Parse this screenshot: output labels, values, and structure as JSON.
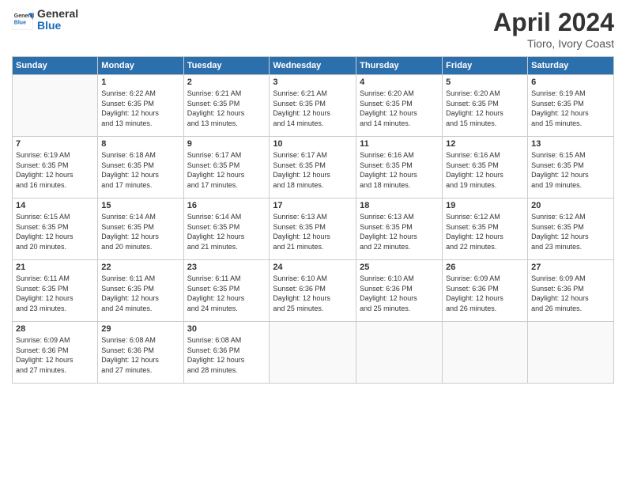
{
  "header": {
    "logo_general": "General",
    "logo_blue": "Blue",
    "month_title": "April 2024",
    "subtitle": "Tioro, Ivory Coast"
  },
  "days_of_week": [
    "Sunday",
    "Monday",
    "Tuesday",
    "Wednesday",
    "Thursday",
    "Friday",
    "Saturday"
  ],
  "weeks": [
    [
      {
        "day": "",
        "info": ""
      },
      {
        "day": "1",
        "info": "Sunrise: 6:22 AM\nSunset: 6:35 PM\nDaylight: 12 hours\nand 13 minutes."
      },
      {
        "day": "2",
        "info": "Sunrise: 6:21 AM\nSunset: 6:35 PM\nDaylight: 12 hours\nand 13 minutes."
      },
      {
        "day": "3",
        "info": "Sunrise: 6:21 AM\nSunset: 6:35 PM\nDaylight: 12 hours\nand 14 minutes."
      },
      {
        "day": "4",
        "info": "Sunrise: 6:20 AM\nSunset: 6:35 PM\nDaylight: 12 hours\nand 14 minutes."
      },
      {
        "day": "5",
        "info": "Sunrise: 6:20 AM\nSunset: 6:35 PM\nDaylight: 12 hours\nand 15 minutes."
      },
      {
        "day": "6",
        "info": "Sunrise: 6:19 AM\nSunset: 6:35 PM\nDaylight: 12 hours\nand 15 minutes."
      }
    ],
    [
      {
        "day": "7",
        "info": "Sunrise: 6:19 AM\nSunset: 6:35 PM\nDaylight: 12 hours\nand 16 minutes."
      },
      {
        "day": "8",
        "info": "Sunrise: 6:18 AM\nSunset: 6:35 PM\nDaylight: 12 hours\nand 17 minutes."
      },
      {
        "day": "9",
        "info": "Sunrise: 6:17 AM\nSunset: 6:35 PM\nDaylight: 12 hours\nand 17 minutes."
      },
      {
        "day": "10",
        "info": "Sunrise: 6:17 AM\nSunset: 6:35 PM\nDaylight: 12 hours\nand 18 minutes."
      },
      {
        "day": "11",
        "info": "Sunrise: 6:16 AM\nSunset: 6:35 PM\nDaylight: 12 hours\nand 18 minutes."
      },
      {
        "day": "12",
        "info": "Sunrise: 6:16 AM\nSunset: 6:35 PM\nDaylight: 12 hours\nand 19 minutes."
      },
      {
        "day": "13",
        "info": "Sunrise: 6:15 AM\nSunset: 6:35 PM\nDaylight: 12 hours\nand 19 minutes."
      }
    ],
    [
      {
        "day": "14",
        "info": "Sunrise: 6:15 AM\nSunset: 6:35 PM\nDaylight: 12 hours\nand 20 minutes."
      },
      {
        "day": "15",
        "info": "Sunrise: 6:14 AM\nSunset: 6:35 PM\nDaylight: 12 hours\nand 20 minutes."
      },
      {
        "day": "16",
        "info": "Sunrise: 6:14 AM\nSunset: 6:35 PM\nDaylight: 12 hours\nand 21 minutes."
      },
      {
        "day": "17",
        "info": "Sunrise: 6:13 AM\nSunset: 6:35 PM\nDaylight: 12 hours\nand 21 minutes."
      },
      {
        "day": "18",
        "info": "Sunrise: 6:13 AM\nSunset: 6:35 PM\nDaylight: 12 hours\nand 22 minutes."
      },
      {
        "day": "19",
        "info": "Sunrise: 6:12 AM\nSunset: 6:35 PM\nDaylight: 12 hours\nand 22 minutes."
      },
      {
        "day": "20",
        "info": "Sunrise: 6:12 AM\nSunset: 6:35 PM\nDaylight: 12 hours\nand 23 minutes."
      }
    ],
    [
      {
        "day": "21",
        "info": "Sunrise: 6:11 AM\nSunset: 6:35 PM\nDaylight: 12 hours\nand 23 minutes."
      },
      {
        "day": "22",
        "info": "Sunrise: 6:11 AM\nSunset: 6:35 PM\nDaylight: 12 hours\nand 24 minutes."
      },
      {
        "day": "23",
        "info": "Sunrise: 6:11 AM\nSunset: 6:35 PM\nDaylight: 12 hours\nand 24 minutes."
      },
      {
        "day": "24",
        "info": "Sunrise: 6:10 AM\nSunset: 6:36 PM\nDaylight: 12 hours\nand 25 minutes."
      },
      {
        "day": "25",
        "info": "Sunrise: 6:10 AM\nSunset: 6:36 PM\nDaylight: 12 hours\nand 25 minutes."
      },
      {
        "day": "26",
        "info": "Sunrise: 6:09 AM\nSunset: 6:36 PM\nDaylight: 12 hours\nand 26 minutes."
      },
      {
        "day": "27",
        "info": "Sunrise: 6:09 AM\nSunset: 6:36 PM\nDaylight: 12 hours\nand 26 minutes."
      }
    ],
    [
      {
        "day": "28",
        "info": "Sunrise: 6:09 AM\nSunset: 6:36 PM\nDaylight: 12 hours\nand 27 minutes."
      },
      {
        "day": "29",
        "info": "Sunrise: 6:08 AM\nSunset: 6:36 PM\nDaylight: 12 hours\nand 27 minutes."
      },
      {
        "day": "30",
        "info": "Sunrise: 6:08 AM\nSunset: 6:36 PM\nDaylight: 12 hours\nand 28 minutes."
      },
      {
        "day": "",
        "info": ""
      },
      {
        "day": "",
        "info": ""
      },
      {
        "day": "",
        "info": ""
      },
      {
        "day": "",
        "info": ""
      }
    ]
  ]
}
